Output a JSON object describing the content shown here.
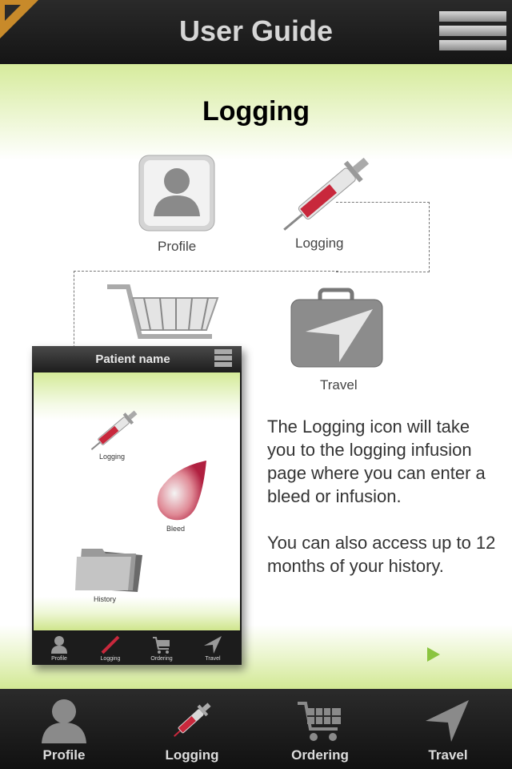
{
  "header": {
    "title": "User Guide"
  },
  "page": {
    "heading": "Logging",
    "icons": {
      "profile": "Profile",
      "logging": "Logging",
      "travel": "Travel"
    },
    "phone": {
      "title": "Patient name",
      "icons": {
        "logging": "Logging",
        "bleed": "Bleed",
        "history": "History"
      },
      "tabs": [
        "Profile",
        "Logging",
        "Ordering",
        "Travel"
      ]
    },
    "description": [
      "The Logging icon will take you to the logging infusion page where you can enter a bleed or infusion.",
      "You can also access up to 12 months of your history."
    ]
  },
  "tabbar": {
    "items": [
      {
        "label": "Profile",
        "icon": "profile-icon"
      },
      {
        "label": "Logging",
        "icon": "syringe-icon"
      },
      {
        "label": "Ordering",
        "icon": "cart-icon"
      },
      {
        "label": "Travel",
        "icon": "travel-arrow-icon"
      }
    ]
  },
  "colors": {
    "accent_green": "#8ac43f",
    "bar_dark": "#1c1c1c",
    "syringe_red": "#c8283c"
  }
}
